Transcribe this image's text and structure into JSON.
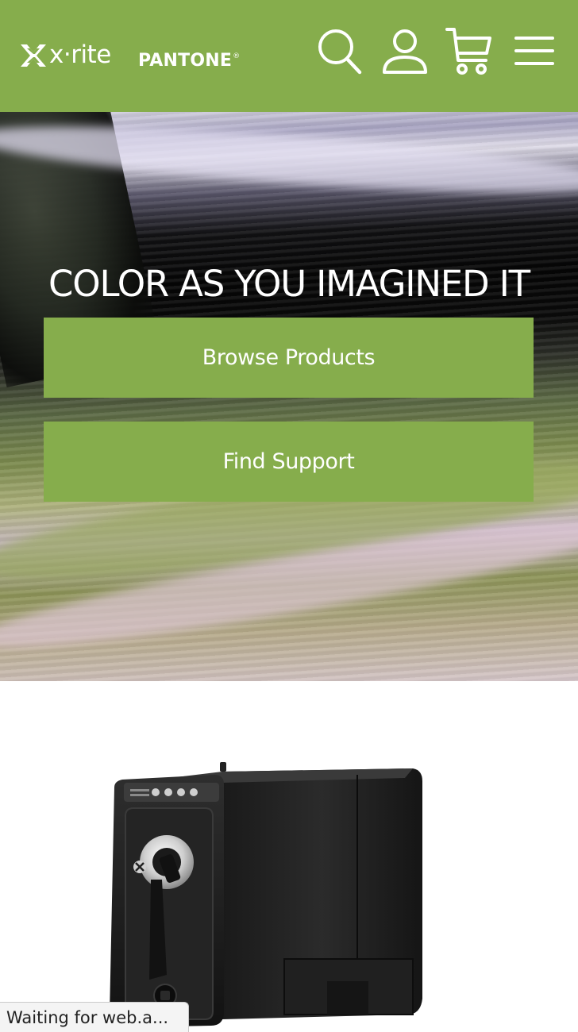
{
  "header": {
    "logo_xrite": "x·rite",
    "logo_pantone": "PANTONE",
    "logo_pantone_mark": "®",
    "brand_color": "#86ad4c",
    "icons": [
      "search-icon",
      "account-icon",
      "cart-icon",
      "menu-icon"
    ]
  },
  "hero": {
    "title": "COLOR AS YOU IMAGINED IT",
    "browse_label": "Browse Products",
    "support_label": "Find Support"
  },
  "product": {
    "image": "spectrophotometer-device"
  },
  "status": {
    "text": "Waiting for web.a..."
  }
}
